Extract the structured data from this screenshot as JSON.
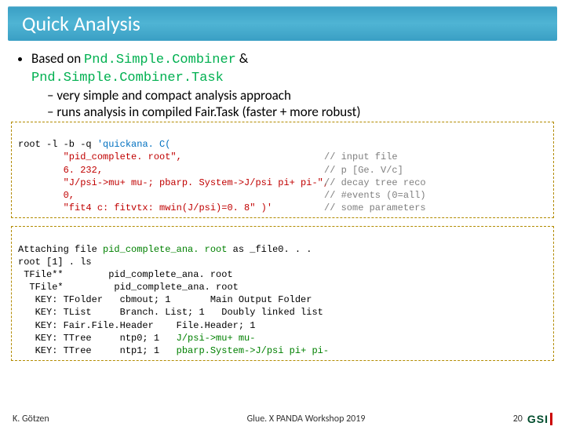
{
  "title": "Quick Analysis",
  "bullet_main": "Based on ",
  "class1": "Pnd.Simple.Combiner",
  "amp": " & ",
  "class2": "Pnd.Simple.Combiner.Task",
  "sub1": "very simple and compact analysis approach",
  "sub2": "runs analysis in compiled Fair.Task (faster + more robust)",
  "code1": {
    "l0a": "root -l -b -q ",
    "l0b": "'quickana. C(",
    "l1": "        \"pid_complete. root\",",
    "l1c": "// input file",
    "l2": "        6. 232,",
    "l2c": "// p [Ge. V/c]",
    "l3": "        \"J/psi->mu+ mu-; pbarp. System->J/psi pi+ pi-\",",
    "l3c": "// decay tree reco",
    "l4": "        0,",
    "l4c": "// #events (0=all)",
    "l5": "        \"fit4 c: fitvtx: mwin(J/psi)=0. 8\" )'",
    "l5c": "// some parameters"
  },
  "code2": {
    "l0a": "Attaching file ",
    "l0b": "pid_complete_ana. root",
    "l0c": " as _file0. . .",
    "l1": "root [1] . ls",
    "l2": " TFile**        pid_complete_ana. root",
    "l3": "  TFile*         pid_complete_ana. root",
    "l4": "   KEY: TFolder   cbmout; 1       Main Output Folder",
    "l5": "   KEY: TList     Branch. List; 1   Doubly linked list",
    "l6": "   KEY: Fair.File.Header    File.Header; 1",
    "l7a": "   KEY: TTree     ntp0; 1   ",
    "l7b": "J/psi->mu+ mu-",
    "l8a": "   KEY: TTree     ntp1; 1   ",
    "l8b": "pbarp.System->J/psi pi+ pi-"
  },
  "footer": {
    "author": "K. Götzen",
    "mid": "Glue. X PANDA Workshop 2019",
    "page": "20",
    "logo": "GSI"
  }
}
